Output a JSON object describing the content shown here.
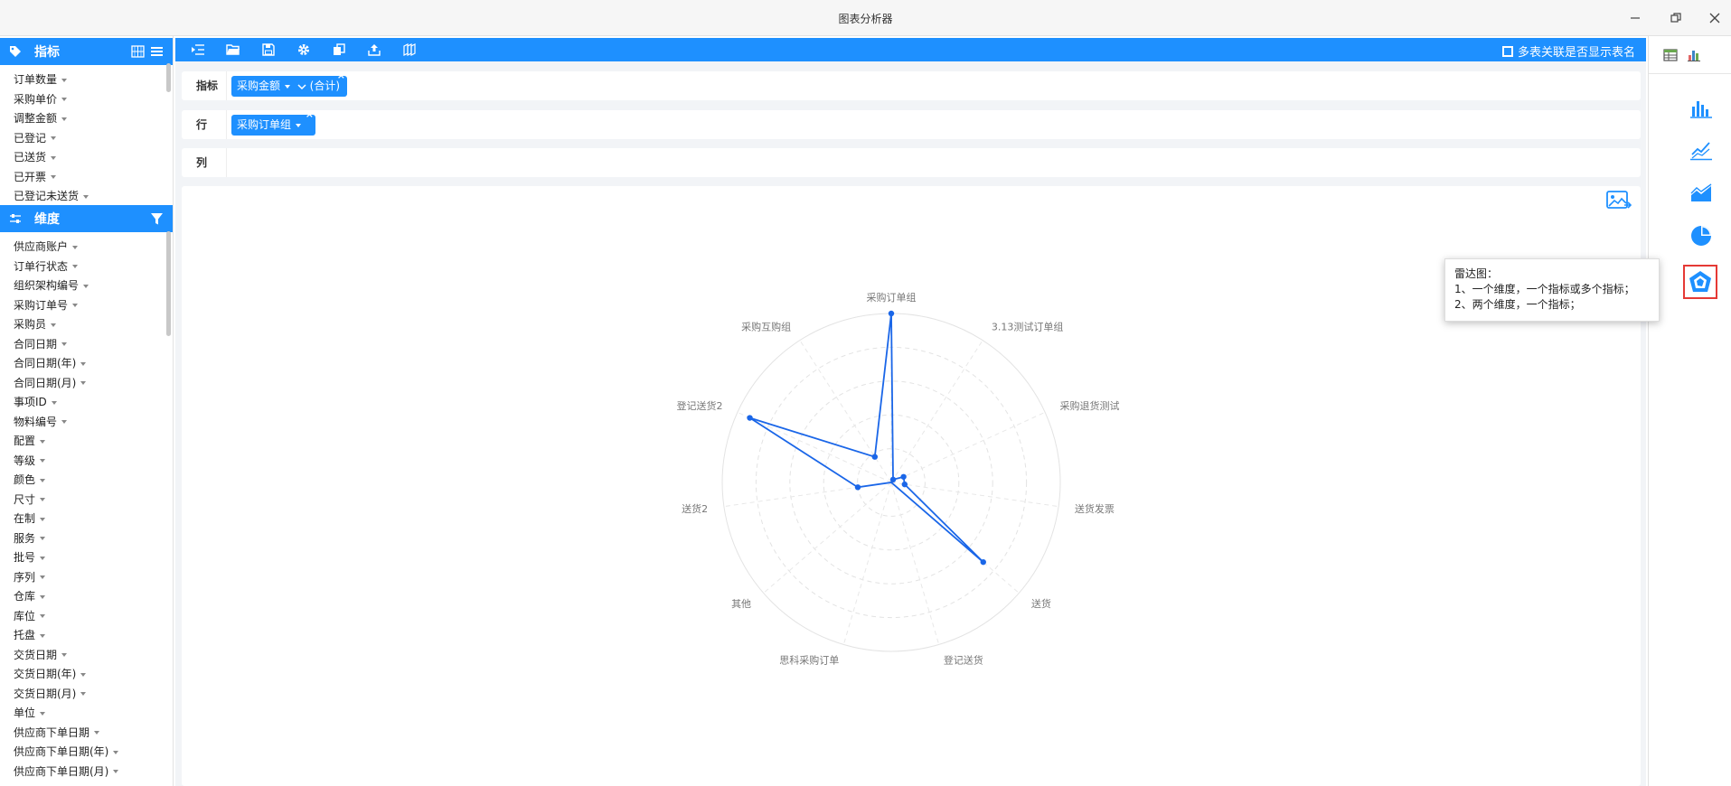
{
  "window": {
    "title": "图表分析器"
  },
  "metrics_panel": {
    "title": "指标",
    "items": [
      "订单数量",
      "采购单价",
      "调整金额",
      "已登记",
      "已送货",
      "已开票",
      "已登记未送货"
    ]
  },
  "dimensions_panel": {
    "title": "维度",
    "items": [
      "供应商账户",
      "订单行状态",
      "组织架构编号",
      "采购订单号",
      "采购员",
      "合同日期",
      "合同日期(年)",
      "合同日期(月)",
      "事项ID",
      "物料编号",
      "配置",
      "等级",
      "颜色",
      "尺寸",
      "在制",
      "服务",
      "批号",
      "序列",
      "仓库",
      "库位",
      "托盘",
      "交货日期",
      "交货日期(年)",
      "交货日期(月)",
      "单位",
      "供应商下单日期",
      "供应商下单日期(年)",
      "供应商下单日期(月)"
    ]
  },
  "toolbar": {
    "multi_table_label": "多表关联是否显示表名"
  },
  "slots": {
    "metric": {
      "label": "指标",
      "chip": "采购金额",
      "chip_suffix": "(合计)",
      "close": "×"
    },
    "row": {
      "label": "行",
      "chip": "采购订单组",
      "close": "×"
    },
    "col": {
      "label": "列"
    }
  },
  "tooltip": {
    "title": "雷达图：",
    "line1": "1、一个维度，一个指标或多个指标；",
    "line2": "2、两个维度，一个指标；"
  },
  "colors": {
    "accent": "#1e90ff",
    "series": "#1a66e8",
    "selected_border": "#e53935"
  },
  "chart_data": {
    "type": "radar",
    "indicators": [
      "采购订单组",
      "3.13测试订单组",
      "采购退货测试",
      "送货发票",
      "送货",
      "登记送货",
      "思科采购订单",
      "其他",
      "送货2",
      "登记送货2",
      "采购互购组"
    ],
    "series": [
      {
        "values": [
          1.0,
          0.02,
          0.08,
          0.08,
          0.72,
          0.0,
          0.0,
          0.0,
          0.2,
          0.92,
          0.18
        ]
      }
    ],
    "rings": 5,
    "legend": "none"
  }
}
